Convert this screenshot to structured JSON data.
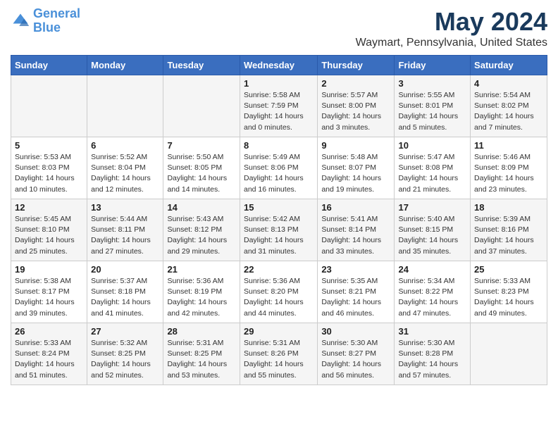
{
  "header": {
    "logo_line1": "General",
    "logo_line2": "Blue",
    "month_title": "May 2024",
    "location": "Waymart, Pennsylvania, United States"
  },
  "weekdays": [
    "Sunday",
    "Monday",
    "Tuesday",
    "Wednesday",
    "Thursday",
    "Friday",
    "Saturday"
  ],
  "weeks": [
    [
      {
        "day": "",
        "sunrise": "",
        "sunset": "",
        "daylight": ""
      },
      {
        "day": "",
        "sunrise": "",
        "sunset": "",
        "daylight": ""
      },
      {
        "day": "",
        "sunrise": "",
        "sunset": "",
        "daylight": ""
      },
      {
        "day": "1",
        "sunrise": "Sunrise: 5:58 AM",
        "sunset": "Sunset: 7:59 PM",
        "daylight": "Daylight: 14 hours and 0 minutes."
      },
      {
        "day": "2",
        "sunrise": "Sunrise: 5:57 AM",
        "sunset": "Sunset: 8:00 PM",
        "daylight": "Daylight: 14 hours and 3 minutes."
      },
      {
        "day": "3",
        "sunrise": "Sunrise: 5:55 AM",
        "sunset": "Sunset: 8:01 PM",
        "daylight": "Daylight: 14 hours and 5 minutes."
      },
      {
        "day": "4",
        "sunrise": "Sunrise: 5:54 AM",
        "sunset": "Sunset: 8:02 PM",
        "daylight": "Daylight: 14 hours and 7 minutes."
      }
    ],
    [
      {
        "day": "5",
        "sunrise": "Sunrise: 5:53 AM",
        "sunset": "Sunset: 8:03 PM",
        "daylight": "Daylight: 14 hours and 10 minutes."
      },
      {
        "day": "6",
        "sunrise": "Sunrise: 5:52 AM",
        "sunset": "Sunset: 8:04 PM",
        "daylight": "Daylight: 14 hours and 12 minutes."
      },
      {
        "day": "7",
        "sunrise": "Sunrise: 5:50 AM",
        "sunset": "Sunset: 8:05 PM",
        "daylight": "Daylight: 14 hours and 14 minutes."
      },
      {
        "day": "8",
        "sunrise": "Sunrise: 5:49 AM",
        "sunset": "Sunset: 8:06 PM",
        "daylight": "Daylight: 14 hours and 16 minutes."
      },
      {
        "day": "9",
        "sunrise": "Sunrise: 5:48 AM",
        "sunset": "Sunset: 8:07 PM",
        "daylight": "Daylight: 14 hours and 19 minutes."
      },
      {
        "day": "10",
        "sunrise": "Sunrise: 5:47 AM",
        "sunset": "Sunset: 8:08 PM",
        "daylight": "Daylight: 14 hours and 21 minutes."
      },
      {
        "day": "11",
        "sunrise": "Sunrise: 5:46 AM",
        "sunset": "Sunset: 8:09 PM",
        "daylight": "Daylight: 14 hours and 23 minutes."
      }
    ],
    [
      {
        "day": "12",
        "sunrise": "Sunrise: 5:45 AM",
        "sunset": "Sunset: 8:10 PM",
        "daylight": "Daylight: 14 hours and 25 minutes."
      },
      {
        "day": "13",
        "sunrise": "Sunrise: 5:44 AM",
        "sunset": "Sunset: 8:11 PM",
        "daylight": "Daylight: 14 hours and 27 minutes."
      },
      {
        "day": "14",
        "sunrise": "Sunrise: 5:43 AM",
        "sunset": "Sunset: 8:12 PM",
        "daylight": "Daylight: 14 hours and 29 minutes."
      },
      {
        "day": "15",
        "sunrise": "Sunrise: 5:42 AM",
        "sunset": "Sunset: 8:13 PM",
        "daylight": "Daylight: 14 hours and 31 minutes."
      },
      {
        "day": "16",
        "sunrise": "Sunrise: 5:41 AM",
        "sunset": "Sunset: 8:14 PM",
        "daylight": "Daylight: 14 hours and 33 minutes."
      },
      {
        "day": "17",
        "sunrise": "Sunrise: 5:40 AM",
        "sunset": "Sunset: 8:15 PM",
        "daylight": "Daylight: 14 hours and 35 minutes."
      },
      {
        "day": "18",
        "sunrise": "Sunrise: 5:39 AM",
        "sunset": "Sunset: 8:16 PM",
        "daylight": "Daylight: 14 hours and 37 minutes."
      }
    ],
    [
      {
        "day": "19",
        "sunrise": "Sunrise: 5:38 AM",
        "sunset": "Sunset: 8:17 PM",
        "daylight": "Daylight: 14 hours and 39 minutes."
      },
      {
        "day": "20",
        "sunrise": "Sunrise: 5:37 AM",
        "sunset": "Sunset: 8:18 PM",
        "daylight": "Daylight: 14 hours and 41 minutes."
      },
      {
        "day": "21",
        "sunrise": "Sunrise: 5:36 AM",
        "sunset": "Sunset: 8:19 PM",
        "daylight": "Daylight: 14 hours and 42 minutes."
      },
      {
        "day": "22",
        "sunrise": "Sunrise: 5:36 AM",
        "sunset": "Sunset: 8:20 PM",
        "daylight": "Daylight: 14 hours and 44 minutes."
      },
      {
        "day": "23",
        "sunrise": "Sunrise: 5:35 AM",
        "sunset": "Sunset: 8:21 PM",
        "daylight": "Daylight: 14 hours and 46 minutes."
      },
      {
        "day": "24",
        "sunrise": "Sunrise: 5:34 AM",
        "sunset": "Sunset: 8:22 PM",
        "daylight": "Daylight: 14 hours and 47 minutes."
      },
      {
        "day": "25",
        "sunrise": "Sunrise: 5:33 AM",
        "sunset": "Sunset: 8:23 PM",
        "daylight": "Daylight: 14 hours and 49 minutes."
      }
    ],
    [
      {
        "day": "26",
        "sunrise": "Sunrise: 5:33 AM",
        "sunset": "Sunset: 8:24 PM",
        "daylight": "Daylight: 14 hours and 51 minutes."
      },
      {
        "day": "27",
        "sunrise": "Sunrise: 5:32 AM",
        "sunset": "Sunset: 8:25 PM",
        "daylight": "Daylight: 14 hours and 52 minutes."
      },
      {
        "day": "28",
        "sunrise": "Sunrise: 5:31 AM",
        "sunset": "Sunset: 8:25 PM",
        "daylight": "Daylight: 14 hours and 53 minutes."
      },
      {
        "day": "29",
        "sunrise": "Sunrise: 5:31 AM",
        "sunset": "Sunset: 8:26 PM",
        "daylight": "Daylight: 14 hours and 55 minutes."
      },
      {
        "day": "30",
        "sunrise": "Sunrise: 5:30 AM",
        "sunset": "Sunset: 8:27 PM",
        "daylight": "Daylight: 14 hours and 56 minutes."
      },
      {
        "day": "31",
        "sunrise": "Sunrise: 5:30 AM",
        "sunset": "Sunset: 8:28 PM",
        "daylight": "Daylight: 14 hours and 57 minutes."
      },
      {
        "day": "",
        "sunrise": "",
        "sunset": "",
        "daylight": ""
      }
    ]
  ]
}
